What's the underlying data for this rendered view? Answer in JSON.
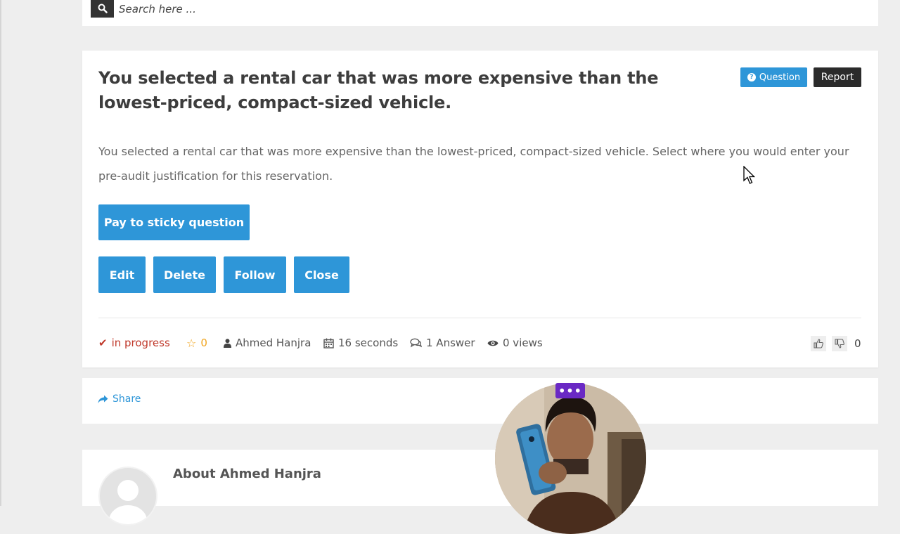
{
  "search": {
    "placeholder": "Search here ..."
  },
  "question": {
    "title": "You selected a rental car that was more expensive than the lowest-priced, compact-sized vehicle.",
    "tag_label": "Question",
    "report_label": "Report",
    "body": "You selected a rental car that was more expensive than the lowest-priced, compact-sized vehicle. Select where you would enter your pre-audit justification for this reservation.",
    "sticky_label": "Pay to sticky question",
    "actions": {
      "edit": "Edit",
      "delete": "Delete",
      "follow": "Follow",
      "close": "Close"
    }
  },
  "meta": {
    "status": "in progress",
    "favorites": "0",
    "author": "Ahmed Hanjra",
    "time": "16 seconds",
    "answers": "1 Answer",
    "views": "0 views",
    "votes": "0"
  },
  "share": {
    "label": "Share"
  },
  "about": {
    "title": "About Ahmed Hanjra"
  },
  "colors": {
    "accent": "#2e96d8",
    "dark": "#2b2b2b",
    "status": "#c0392b",
    "star": "#f0a520",
    "webcam_menu": "#6a29c4"
  }
}
